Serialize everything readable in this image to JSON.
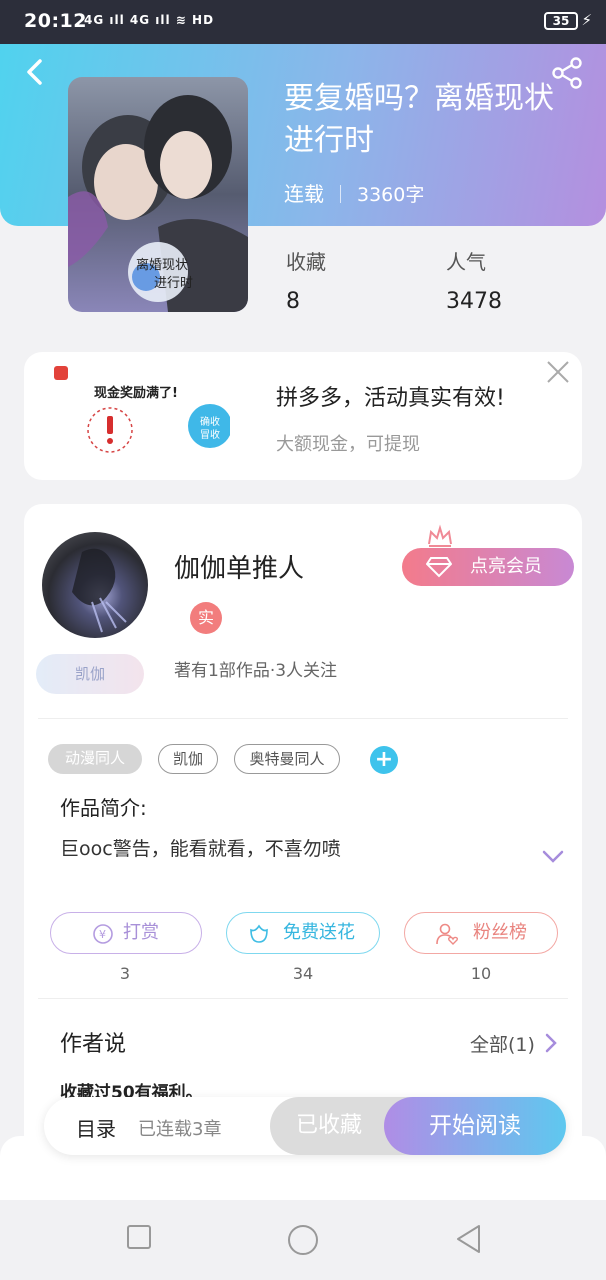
{
  "status_bar": {
    "time": "20:12",
    "signal": "4G ıll 4G ıll ≋ HD",
    "battery": "35"
  },
  "book": {
    "title": "要复婚吗？离婚现状进行时",
    "status": "连载",
    "word_count": "3360字",
    "stats": [
      {
        "label": "收藏",
        "value": "8"
      },
      {
        "label": "人气",
        "value": "3478"
      }
    ]
  },
  "ad": {
    "title": "拼多多，活动真实有效!",
    "subtitle": "大额现金，可提现",
    "image_text": "现金奖励满了!",
    "image_button": "确收 冒收"
  },
  "author": {
    "name": "伽伽单推人",
    "badge": "凯伽",
    "verified": "实",
    "works": "著有1部作品·3人关注",
    "vip_button": "点亮会员"
  },
  "tags": [
    "动漫同人",
    "凯伽",
    "奥特曼同人"
  ],
  "intro": {
    "title": "作品简介:",
    "text": "巨ooc警告，能看就看，不喜勿喷"
  },
  "actions": [
    {
      "label": "打赏",
      "count": "3",
      "color": "#b99ce0"
    },
    {
      "label": "免费送花",
      "count": "34",
      "color": "#4fc8e6"
    },
    {
      "label": "粉丝榜",
      "count": "10",
      "color": "#ef8a86"
    }
  ],
  "author_say": {
    "title": "作者说",
    "all_link": "全部(1)",
    "text": "收藏过50有福利。"
  },
  "bottom_bar": {
    "toc": "目录",
    "toc_sub": "已连载3章",
    "fav_button": "已收藏",
    "read_button": "开始阅读"
  },
  "colors": {
    "accent_cyan": "#4fd3ee",
    "accent_purple": "#b48fdf",
    "pink": "#f37b8b"
  }
}
